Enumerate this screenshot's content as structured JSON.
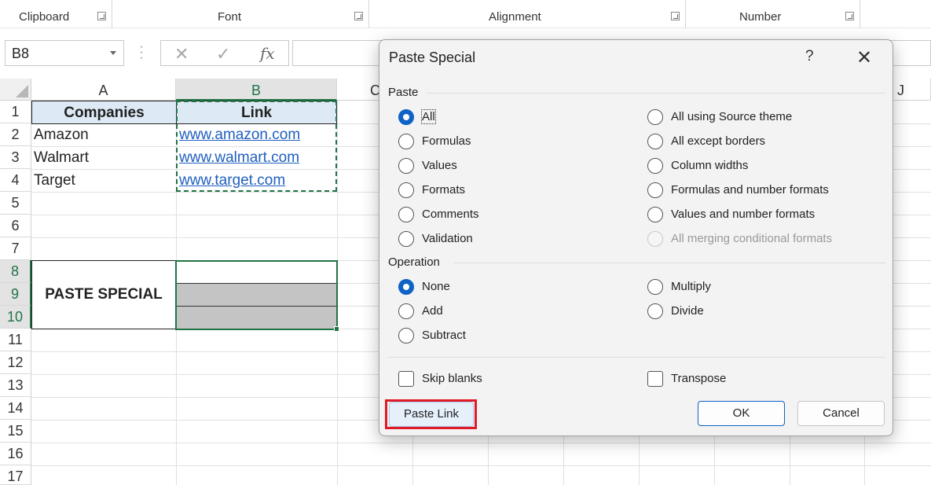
{
  "ribbon": {
    "groups": [
      {
        "label": "Clipboard"
      },
      {
        "label": "Font"
      },
      {
        "label": "Alignment"
      },
      {
        "label": "Number"
      }
    ]
  },
  "formula_bar": {
    "name_box": "B8",
    "fx_label": "fx",
    "cancel_glyph": "✕",
    "enter_glyph": "✓"
  },
  "grid": {
    "columns": [
      "A",
      "B",
      "C",
      "J"
    ],
    "rows": [
      "1",
      "2",
      "3",
      "4",
      "5",
      "6",
      "7",
      "8",
      "9",
      "10",
      "11",
      "12",
      "13",
      "14",
      "15",
      "16",
      "17"
    ],
    "selected_column": "B",
    "selected_rows": [
      "8",
      "9",
      "10"
    ],
    "headers": {
      "a1": "Companies",
      "b1": "Link"
    },
    "companies": [
      "Amazon",
      "Walmart",
      "Target"
    ],
    "links": [
      "www.amazon.com",
      "www.walmart.com",
      "www.target.com"
    ],
    "merged_label": "PASTE SPECIAL"
  },
  "dialog": {
    "title": "Paste Special",
    "help": "?",
    "close": "✕",
    "paste_section": "Paste",
    "paste_options_left": [
      "All",
      "Formulas",
      "Values",
      "Formats",
      "Comments",
      "Validation"
    ],
    "paste_options_right": [
      "All using Source theme",
      "All except borders",
      "Column widths",
      "Formulas and number formats",
      "Values and number formats",
      "All merging conditional formats"
    ],
    "paste_selected": "All",
    "operation_section": "Operation",
    "operation_left": [
      "None",
      "Add",
      "Subtract"
    ],
    "operation_right": [
      "Multiply",
      "Divide"
    ],
    "operation_selected": "None",
    "skip_blanks": "Skip blanks",
    "transpose": "Transpose",
    "paste_link": "Paste Link",
    "ok": "OK",
    "cancel": "Cancel"
  },
  "colors": {
    "accent": "#217346",
    "radio_selected": "#0f62c6",
    "highlight_box": "#e01b24",
    "link": "#1f5fbf",
    "header_fill": "#dde9f5"
  }
}
